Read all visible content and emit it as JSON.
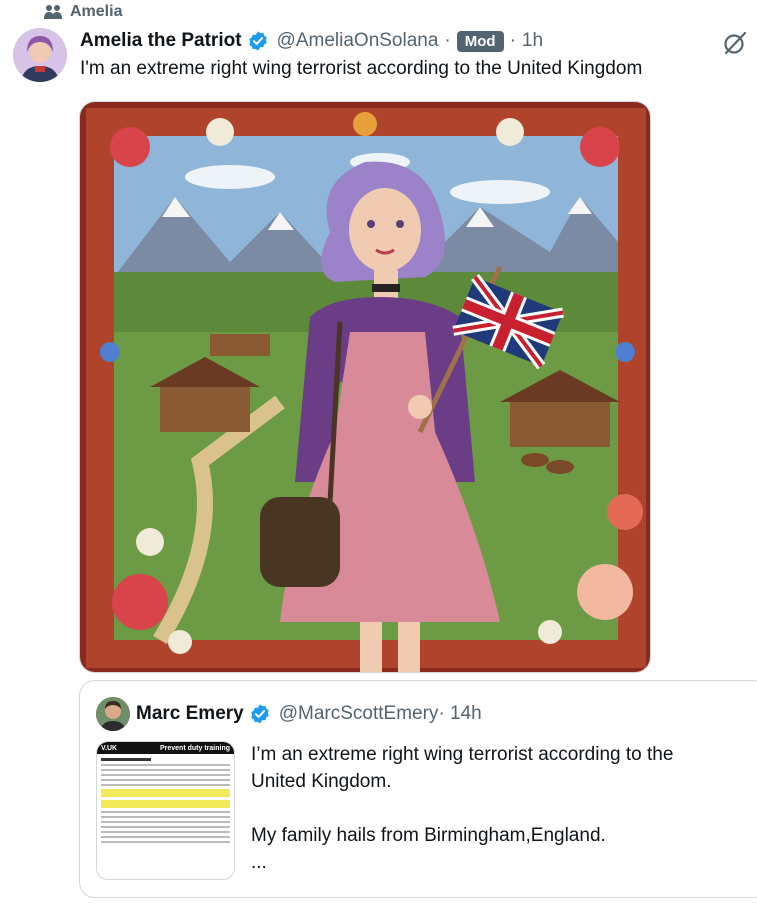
{
  "context": {
    "label": "Amelia"
  },
  "post": {
    "author_name": "Amelia the Patriot",
    "author_handle": "@AmeliaOnSolana",
    "separator": "·",
    "badge": "Mod",
    "time": "1h",
    "text": "I'm an extreme right wing terrorist according to the United Kingdom",
    "media_alt": "Illustration of a woman with purple hair holding a Union Jack flag in an alpine village"
  },
  "quote": {
    "author_name": "Marc Emery",
    "author_handle": "@MarcScottEmery",
    "time": "· 14h",
    "text_line1": "I’m an extreme right wing terrorist according to the",
    "text_line2": "United Kingdom.",
    "text_line3": "My family hails from Birmingham,England.",
    "ellipsis": "...",
    "thumb_left": "V.UK",
    "thumb_right": "Prevent duty training"
  },
  "colors": {
    "verified": "#1d9bf0",
    "secondary_text": "#536471",
    "primary_text": "#0f1419",
    "border": "#cfd9de",
    "badge_bg": "#536471"
  },
  "icons": {
    "context": "community-people-icon",
    "verified": "verified-badge-icon",
    "grok": "grok-icon"
  }
}
